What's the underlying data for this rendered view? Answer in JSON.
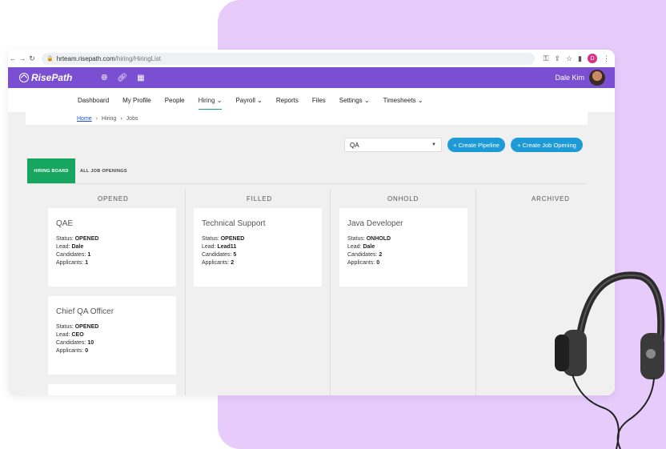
{
  "browser": {
    "url_host": "hrteam.risepath.com",
    "url_path": "/hiring/HiringList",
    "profile_initial": "D"
  },
  "app": {
    "brand": "RisePath",
    "user_name": "Dale Kim"
  },
  "menu": {
    "items": [
      "Dashboard",
      "My Profile",
      "People",
      "Hiring",
      "Payroll",
      "Reports",
      "Files",
      "Settings",
      "Timesheets"
    ]
  },
  "breadcrumb": {
    "home": "Home",
    "hiring": "Hiring",
    "jobs": "Jobs"
  },
  "toolbar": {
    "pipeline_selected": "QA",
    "create_pipeline": "+ Create Pipeline",
    "create_job": "+ Create Job Opening"
  },
  "tabs": {
    "hiring_board": "HIRING BOARD",
    "all_jobs": "ALL JOB OPENINGS"
  },
  "columns": [
    "OPENED",
    "FILLED",
    "ONHOLD",
    "ARCHIVED"
  ],
  "labels": {
    "status": "Status: ",
    "lead": "Lead: ",
    "candidates": "Candidates: ",
    "applicants": "Applicants: "
  },
  "cards": [
    {
      "title": "QAE",
      "status": "OPENED",
      "lead": "Dale",
      "candidates": "1",
      "applicants": "1"
    },
    {
      "title": "Chief QA Officer",
      "status": "OPENED",
      "lead": "CEO",
      "candidates": "10",
      "applicants": "0"
    },
    {
      "title": "Technical Support",
      "status": "OPENED",
      "lead": "Lead11",
      "candidates": "5",
      "applicants": "2"
    },
    {
      "title": "Java Developer",
      "status": "ONHOLD",
      "lead": "Dale",
      "candidates": "2",
      "applicants": "0"
    }
  ],
  "colors": {
    "lilac_bg": "#e6cbfb",
    "brand_purple": "#7b4fd1",
    "accent_green": "#16a660",
    "button_blue": "#1e9bd7"
  }
}
